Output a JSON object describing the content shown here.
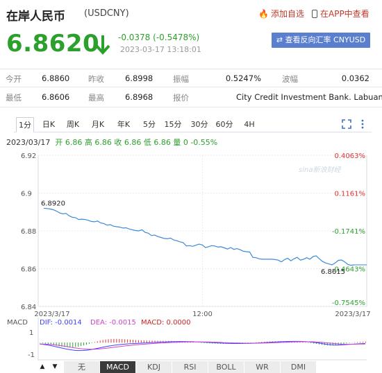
{
  "header": {
    "title": "在岸人民币",
    "code": "(USDCNY)",
    "add_favorite": "添加自选",
    "open_in_app": "在APP中查看",
    "price": "6.8620",
    "change": "-0.0378 (-0.5478%)",
    "time": "2023-03-17 13:18:01",
    "reverse_button": "查看反向汇率 CNYUSD"
  },
  "quote": {
    "row1": [
      {
        "label": "今开",
        "value": "6.8860"
      },
      {
        "label": "昨收",
        "value": "6.8998"
      },
      {
        "label": "振幅",
        "value": "0.5247%"
      },
      {
        "label": "波幅",
        "value": "0.0362"
      }
    ],
    "row2": [
      {
        "label": "最低",
        "value": "6.8606"
      },
      {
        "label": "最高",
        "value": "6.8968"
      },
      {
        "label": "报价",
        "value": "City Credit Investment Bank. Labuan"
      }
    ]
  },
  "tabs": [
    "1分",
    "日K",
    "周K",
    "月K",
    "年K",
    "5分",
    "15分",
    "30分",
    "60分",
    "4H"
  ],
  "active_tab": "1分",
  "summary": {
    "date": "2023/03/17",
    "items": "开 6.86 高 6.86 收 6.86 低 6.86 量 0 -0.55%"
  },
  "colors": {
    "up": "#e03030",
    "down": "#2ca02c",
    "line": "#3a8ad6",
    "macd_dif": "#4040ff",
    "macd_dea": "#cc44cc"
  },
  "chart_data": {
    "type": "line",
    "y_ticks": [
      "6.92",
      "6.9",
      "6.88",
      "6.86",
      "6.84"
    ],
    "y_values": [
      6.92,
      6.9,
      6.88,
      6.86,
      6.84
    ],
    "pct_labels": [
      "0.4063%",
      "0.1161%",
      "-0.1741%",
      "-0.4643%",
      "-0.7545%"
    ],
    "x_labels": [
      "2023/3/17",
      "12:00",
      "2023/3/17"
    ],
    "ylim": [
      6.84,
      6.92
    ],
    "annotations": {
      "open": "6.8920",
      "last": "6.8615"
    },
    "watermark": "sina新浪财经",
    "series": [
      {
        "values": [
          6.892,
          6.8918,
          6.8916,
          6.8912,
          6.8905,
          6.8895,
          6.889,
          6.8893,
          6.888,
          6.8872,
          6.887,
          6.886,
          6.8862,
          6.886,
          6.8856,
          6.885,
          6.8848,
          6.8852,
          6.8842,
          6.8838,
          6.883,
          6.8833,
          6.8825,
          6.8822,
          6.882,
          6.8815,
          6.8816,
          6.881,
          6.8806,
          6.8802,
          6.88,
          6.8806,
          6.8792,
          6.8788,
          6.8775,
          6.8778,
          6.877,
          6.8765,
          6.876,
          6.8758,
          6.8762,
          6.8752,
          6.8748,
          6.8742,
          6.8738,
          6.872,
          6.8722,
          6.8718,
          6.8724,
          6.873,
          6.8726,
          6.8712,
          6.8716,
          6.8722,
          6.872,
          6.8714,
          6.8716,
          6.871,
          6.8704,
          6.8712,
          6.8702,
          6.8706,
          6.87,
          6.8692,
          6.869,
          6.8688,
          6.866,
          6.8658,
          6.8652,
          6.865,
          6.865,
          6.865,
          6.865,
          6.8648,
          6.8645,
          6.8636,
          6.8648,
          6.8655,
          6.8642,
          6.8652,
          6.866,
          6.8645,
          6.865,
          6.8658,
          6.865,
          6.8664,
          6.8668,
          6.8652,
          6.8638,
          6.863,
          6.8625,
          6.862,
          6.863,
          6.8644,
          6.8646,
          6.8636,
          6.8622,
          6.8618,
          6.862
        ]
      }
    ]
  },
  "macd": {
    "label": "MACD",
    "dif": "DIF: -0.0014",
    "dea": "DEA: -0.0015",
    "macd": "MACD: 0.0000",
    "y_ticks": [
      "1",
      "-1"
    ]
  },
  "toolbar": {
    "buttons": [
      "无",
      "MACD",
      "KDJ",
      "RSI",
      "BOLL",
      "WR",
      "DMI"
    ],
    "active": "MACD",
    "up_arrow": "▲",
    "down_arrow": "▼"
  }
}
